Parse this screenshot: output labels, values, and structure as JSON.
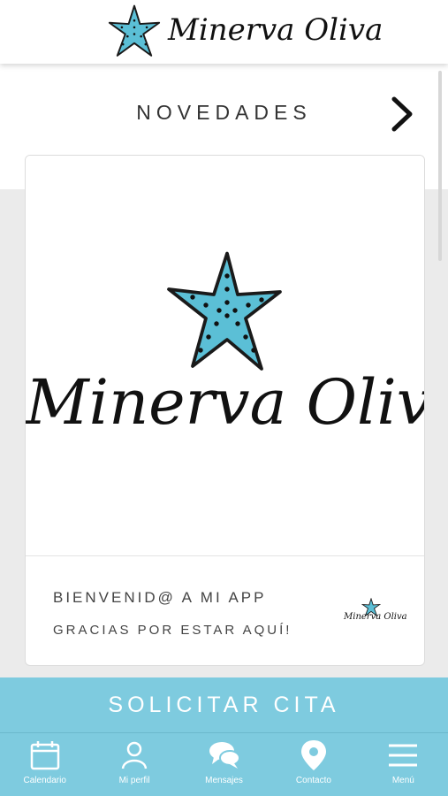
{
  "header": {
    "brand_name": "Minerva Oliva",
    "star_icon": "starfish-icon"
  },
  "news": {
    "title": "NOVEDADES",
    "next_icon": "chevron-right-icon"
  },
  "card": {
    "image_brand": "Minerva Oliva",
    "title": "BIENVENID@ A MI APP",
    "subtitle": "GRACIAS POR ESTAR AQUÍ!",
    "mini_brand": "Minerva Oliva"
  },
  "cta": {
    "label": "SOLICITAR CITA"
  },
  "bottom_nav": {
    "items": [
      {
        "label": "Calendario",
        "icon": "calendar-icon"
      },
      {
        "label": "Mi perfil",
        "icon": "user-icon"
      },
      {
        "label": "Mensajes",
        "icon": "chat-bubbles-icon"
      },
      {
        "label": "Contacto",
        "icon": "location-pin-icon"
      },
      {
        "label": "Menú",
        "icon": "hamburger-menu-icon"
      }
    ]
  },
  "colors": {
    "accent": "#7ecbdf",
    "star_fill": "#5bbfd6",
    "text_dark": "#111111"
  }
}
